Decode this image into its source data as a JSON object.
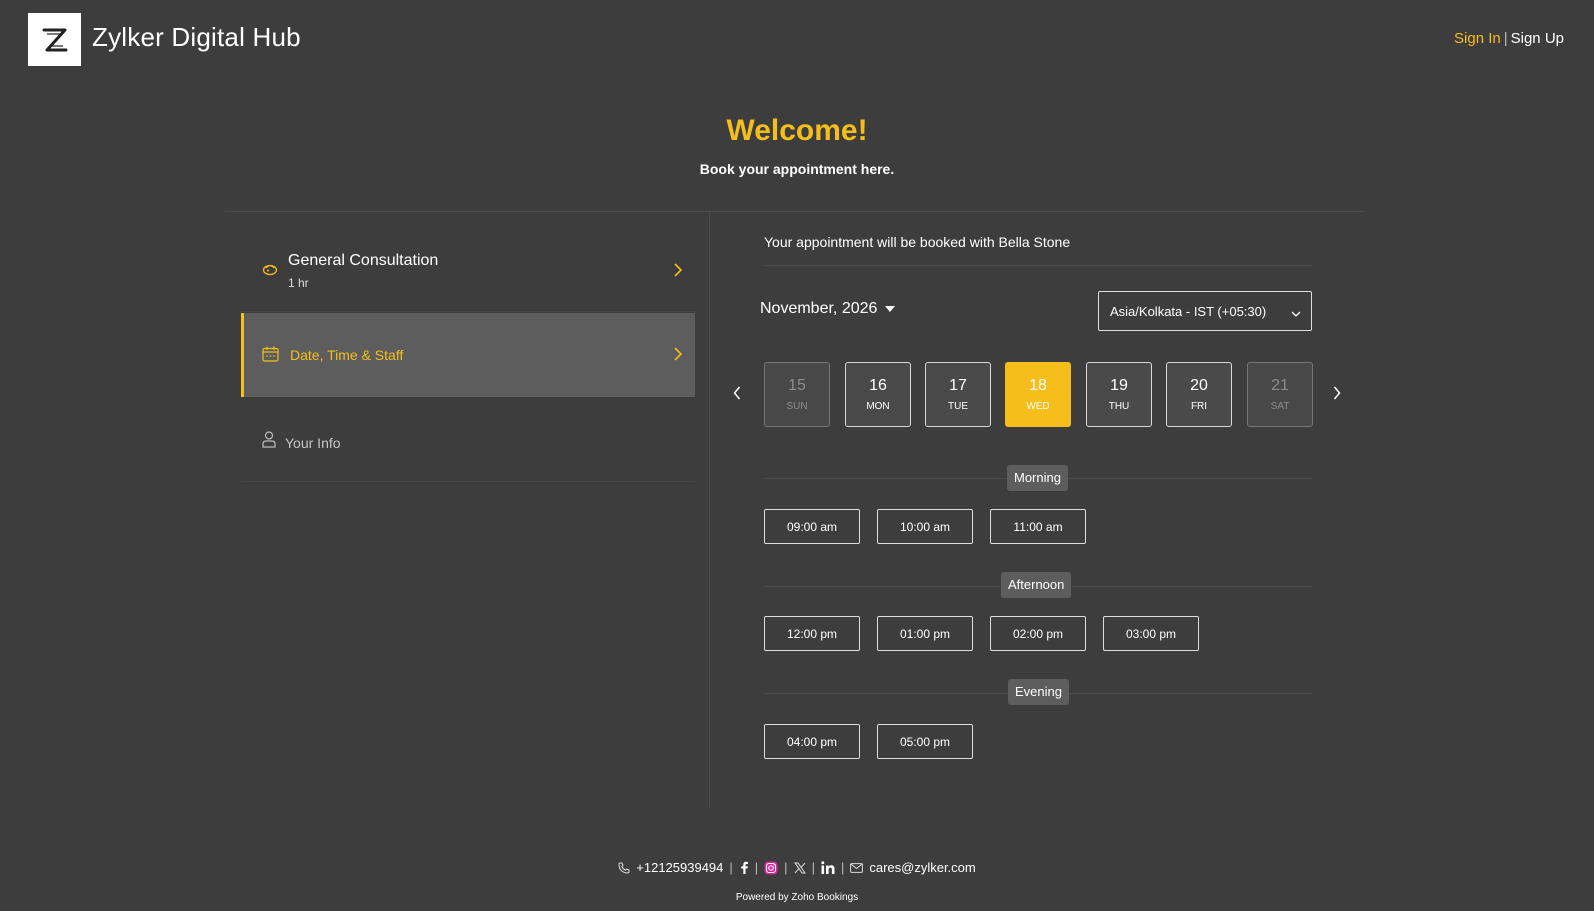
{
  "header": {
    "brand_name": "Zylker Digital Hub",
    "auth": {
      "sign_in": "Sign In",
      "separator": "|",
      "sign_up": "Sign Up"
    }
  },
  "hero": {
    "title": "Welcome!",
    "subtitle": "Book your appointment here."
  },
  "steps": {
    "service": {
      "title": "General Consultation",
      "duration": "1 hr"
    },
    "datetime": {
      "title": "Date, Time & Staff"
    },
    "info": {
      "title": "Your Info"
    }
  },
  "booking": {
    "staff_message": "Your appointment will be booked with Bella Stone",
    "month": "November, 2026",
    "timezone": "Asia/Kolkata - IST (+05:30)"
  },
  "days": [
    {
      "num": "15",
      "dow": "SUN"
    },
    {
      "num": "16",
      "dow": "MON"
    },
    {
      "num": "17",
      "dow": "TUE"
    },
    {
      "num": "18",
      "dow": "WED"
    },
    {
      "num": "19",
      "dow": "THU"
    },
    {
      "num": "20",
      "dow": "FRI"
    },
    {
      "num": "21",
      "dow": "SAT"
    }
  ],
  "periods": {
    "morning": {
      "label": "Morning",
      "slots": [
        "09:00 am",
        "10:00 am",
        "11:00 am"
      ]
    },
    "afternoon": {
      "label": "Afternoon",
      "slots": [
        "12:00 pm",
        "01:00 pm",
        "02:00 pm",
        "03:00 pm"
      ]
    },
    "evening": {
      "label": "Evening",
      "slots": [
        "04:00 pm",
        "05:00 pm"
      ]
    }
  },
  "footer": {
    "phone": "+12125939494",
    "email": "cares@zylker.com",
    "powered_by": "Powered by Zoho Bookings"
  },
  "colors": {
    "accent": "#f5be1a",
    "background": "#3d3d3d",
    "active_step": "#5d5d5d"
  }
}
